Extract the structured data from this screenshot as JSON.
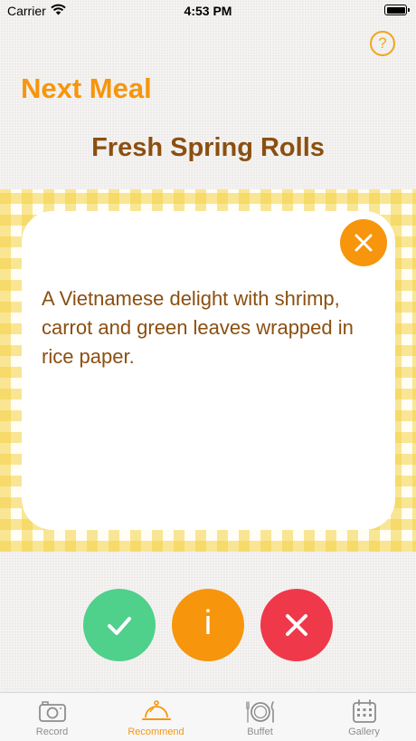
{
  "status_bar": {
    "carrier": "Carrier",
    "time": "4:53 PM"
  },
  "header": {
    "help_label": "?",
    "app_title": "Next Meal"
  },
  "recommendation": {
    "meal_name": "Fresh Spring Rolls",
    "description": "A Vietnamese delight with shrimp, carrot and green leaves wrapped in rice paper."
  },
  "actions": {
    "info_label": "i"
  },
  "tabs": [
    {
      "label": "Record",
      "icon": "camera-icon",
      "active": false
    },
    {
      "label": "Recommend",
      "icon": "cloche-icon",
      "active": true
    },
    {
      "label": "Buffet",
      "icon": "plate-cutlery-icon",
      "active": false
    },
    {
      "label": "Gallery",
      "icon": "calendar-icon",
      "active": false
    }
  ],
  "colors": {
    "accent_orange": "#f7950c",
    "text_brown": "#8b4f10",
    "accept_green": "#4fd08b",
    "reject_red": "#f0384b",
    "gingham_yellow": "#f4d246"
  }
}
